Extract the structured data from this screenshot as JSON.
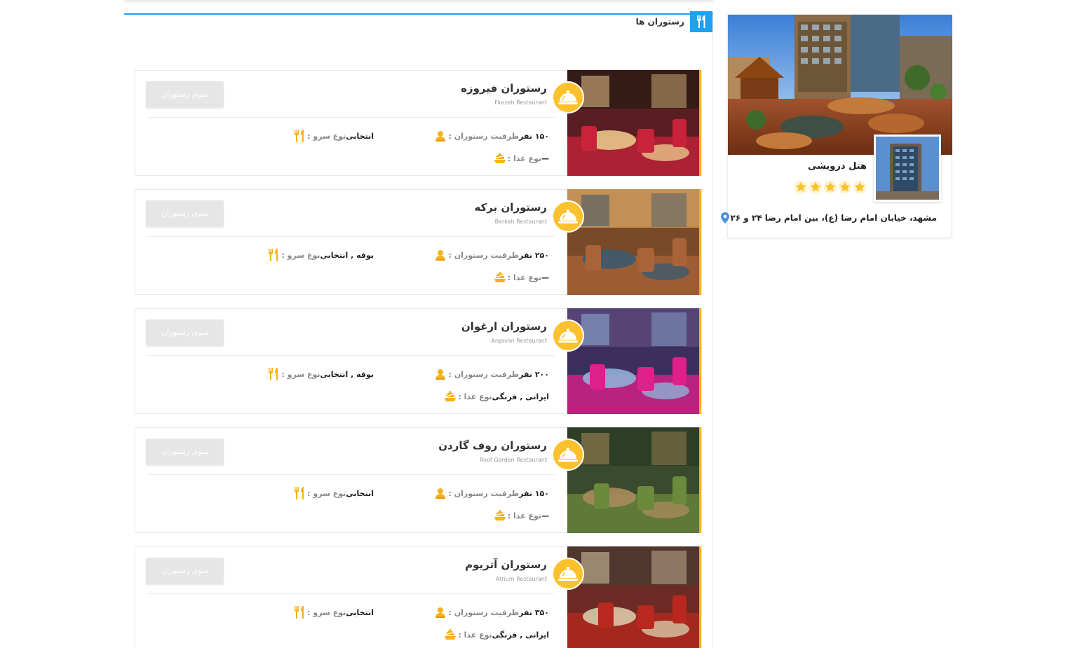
{
  "section": {
    "title": "رستوران ها",
    "icon": "fork-knife-icon",
    "accent": "#1da1f2"
  },
  "labels": {
    "capacity": "ظرفیت رستوران :",
    "serve_type": "نوع سرو :",
    "food_type": "نوع غذا :",
    "menu_button": "منوی رستوران"
  },
  "colors": {
    "badge": "#fcc12c",
    "icon": "#f6b21a",
    "button": "#e6e6e6"
  },
  "restaurants": [
    {
      "name": "رستوران فیروزه",
      "subtitle": "Firozeh Restaurant",
      "capacity": "۱۵۰ نفر",
      "serve": "انتخابی",
      "food": "—"
    },
    {
      "name": "رستوران برکه",
      "subtitle": "Berkeh Restaurant",
      "capacity": "۲۵۰ نفر",
      "serve": "بوفه , انتخابی",
      "food": "—"
    },
    {
      "name": "رستوران ارغوان",
      "subtitle": "Arqavan Restaurant",
      "capacity": "۲۰۰ نفر",
      "serve": "بوفه , انتخابی",
      "food": "ایرانی , فرنگی"
    },
    {
      "name": "رستوران روف گاردن",
      "subtitle": "Roof Garden Restaurant",
      "capacity": "۱۵۰ نفر",
      "serve": "انتخابی",
      "food": "—"
    },
    {
      "name": "رستوران آتریوم",
      "subtitle": "Atrium Restaurant",
      "capacity": "۳۵۰ نفر",
      "serve": "انتخابی",
      "food": "ایرانی , فرنگی"
    }
  ],
  "hotel": {
    "name": "هتل درویشی",
    "stars": 5,
    "address": "مشهد، خیابان امام رضا (ع)، بین امام رضا ۲۴ و ۲۶",
    "pin_color": "#4a90e2",
    "star_color": "#fcc12c"
  }
}
